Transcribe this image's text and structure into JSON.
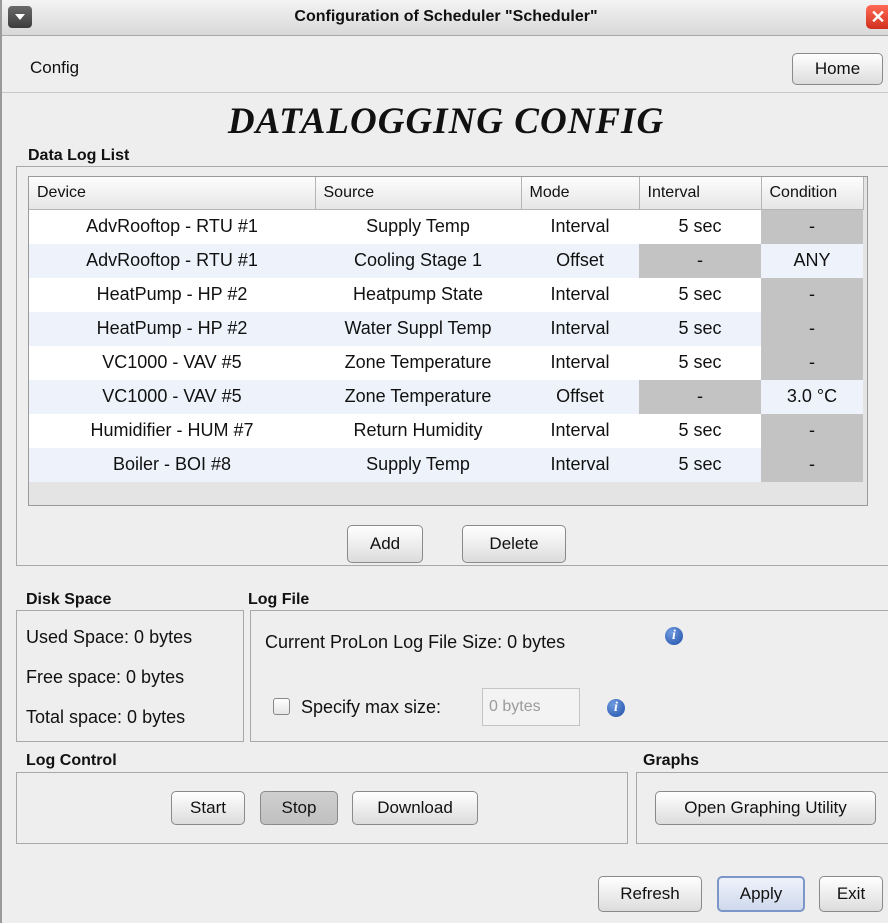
{
  "window": {
    "title": "Configuration of Scheduler \"Scheduler\"",
    "close_glyph": "✕"
  },
  "toolbar": {
    "menu_config": "Config",
    "home_label": "Home"
  },
  "page_title": "DATALOGGING CONFIG",
  "data_log": {
    "section_label": "Data Log List",
    "columns": [
      "Device",
      "Source",
      "Mode",
      "Interval",
      "Condition"
    ],
    "rows": [
      {
        "device": "AdvRooftop - RTU #1",
        "source": "Supply Temp",
        "mode": "Interval",
        "interval": "5 sec",
        "condition": "-"
      },
      {
        "device": "AdvRooftop - RTU #1",
        "source": "Cooling Stage 1",
        "mode": "Offset",
        "interval": "-",
        "condition": "ANY"
      },
      {
        "device": "HeatPump - HP #2",
        "source": "Heatpump State",
        "mode": "Interval",
        "interval": "5 sec",
        "condition": "-"
      },
      {
        "device": "HeatPump - HP #2",
        "source": "Water Suppl Temp",
        "mode": "Interval",
        "interval": "5 sec",
        "condition": "-"
      },
      {
        "device": "VC1000 - VAV #5",
        "source": "Zone Temperature",
        "mode": "Interval",
        "interval": "5 sec",
        "condition": "-"
      },
      {
        "device": "VC1000 - VAV #5",
        "source": "Zone Temperature",
        "mode": "Offset",
        "interval": "-",
        "condition": "3.0 °C"
      },
      {
        "device": "Humidifier - HUM #7",
        "source": "Return Humidity",
        "mode": "Interval",
        "interval": "5 sec",
        "condition": "-"
      },
      {
        "device": "Boiler - BOI #8",
        "source": "Supply Temp",
        "mode": "Interval",
        "interval": "5 sec",
        "condition": "-"
      }
    ],
    "add_label": "Add",
    "delete_label": "Delete"
  },
  "disk_space": {
    "section_label": "Disk Space",
    "used": "Used Space: 0 bytes",
    "free": "Free space: 0 bytes",
    "total": "Total space: 0 bytes"
  },
  "log_file": {
    "section_label": "Log File",
    "current_size": "Current ProLon Log File Size: 0 bytes",
    "specify_max_label": "Specify max size:",
    "max_size_value": "0 bytes",
    "info_glyph": "i"
  },
  "log_control": {
    "section_label": "Log Control",
    "start_label": "Start",
    "stop_label": "Stop",
    "download_label": "Download"
  },
  "graphs": {
    "section_label": "Graphs",
    "open_label": "Open Graphing Utility"
  },
  "footer": {
    "refresh_label": "Refresh",
    "apply_label": "Apply",
    "exit_label": "Exit"
  }
}
